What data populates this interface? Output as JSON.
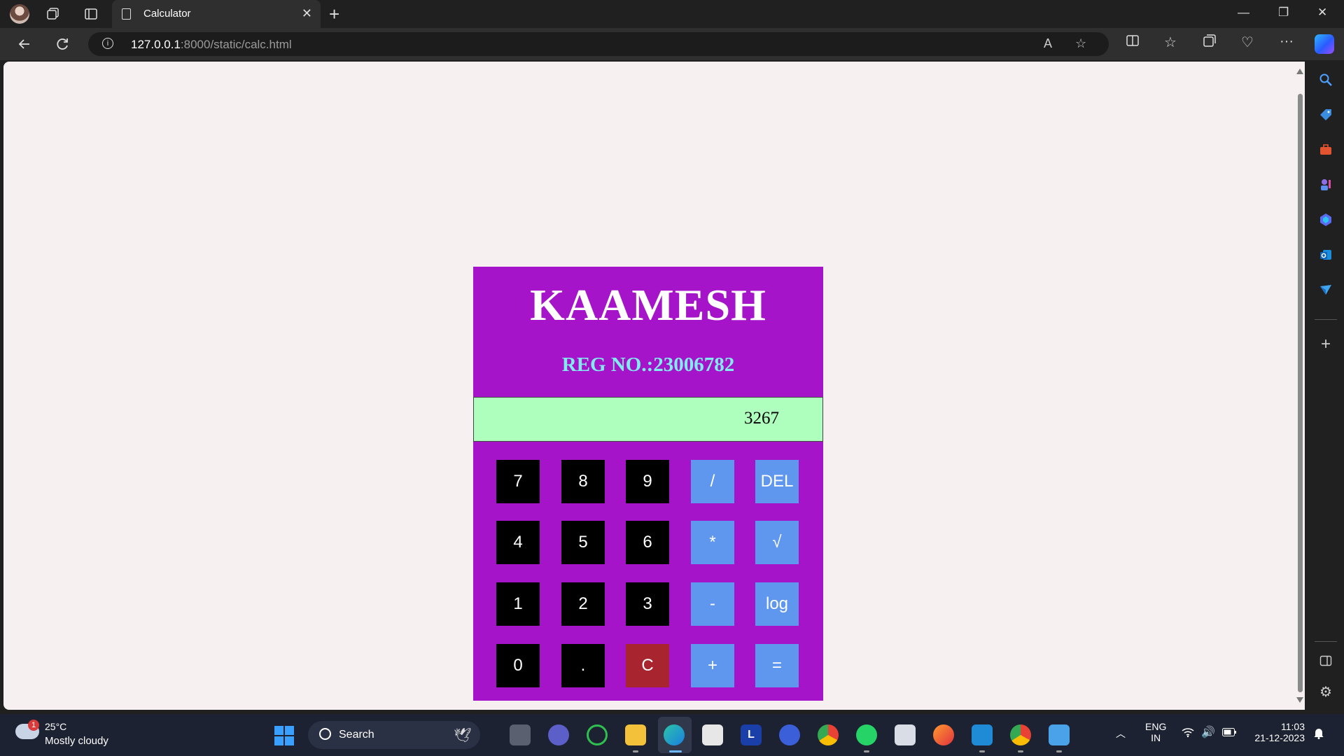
{
  "browser": {
    "tab_title": "Calculator",
    "url_host": "127.0.0.1",
    "url_path": ":8000/static/calc.html"
  },
  "calculator": {
    "name": "KAAMESH",
    "reg_no": "REG NO.:23006782",
    "display_value": "3267",
    "keys": {
      "k7": "7",
      "k8": "8",
      "k9": "9",
      "div": "/",
      "del": "DEL",
      "k4": "4",
      "k5": "5",
      "k6": "6",
      "mul": "*",
      "sqrt": "√",
      "k1": "1",
      "k2": "2",
      "k3": "3",
      "sub": "-",
      "log": "log",
      "k0": "0",
      "dot": ".",
      "clear": "C",
      "add": "+",
      "eq": "="
    },
    "colors": {
      "panel": "#a514c9",
      "display": "#aeffbe",
      "digit_key": "#000000",
      "operator_key": "#5f97ee",
      "clear_key": "#a8242f",
      "reg_text": "#80ecf0"
    }
  },
  "taskbar": {
    "weather_temp": "25°C",
    "weather_condition": "Mostly cloudy",
    "weather_badge": "1",
    "search_label": "Search",
    "lang_top": "ENG",
    "lang_bottom": "IN",
    "time": "11:03",
    "date": "21-12-2023"
  }
}
